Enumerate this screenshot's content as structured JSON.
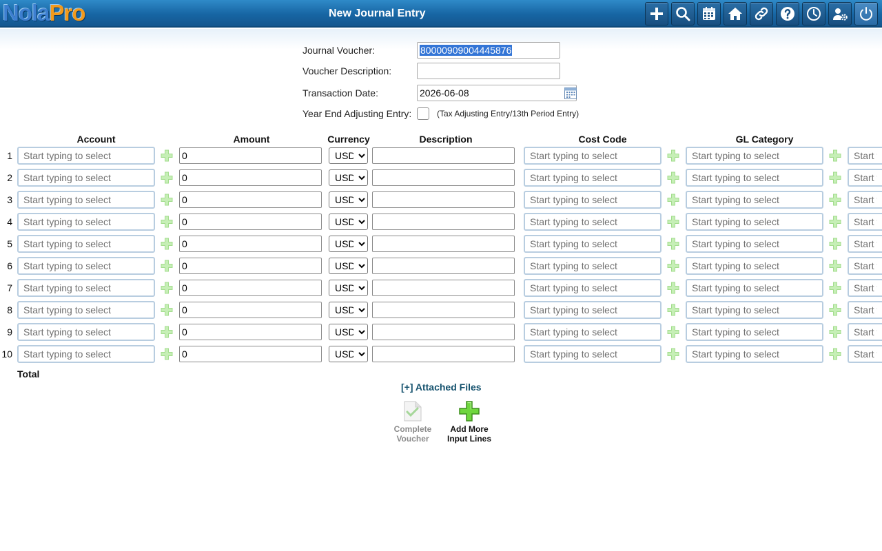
{
  "header": {
    "logo_part1": "Nola",
    "logo_part2": "Pro",
    "title": "New Journal Entry",
    "toolbar_icons": [
      "plus-icon",
      "search-icon",
      "calendar-icon",
      "home-icon",
      "link-icon",
      "help-icon",
      "clock-icon",
      "user-settings-icon",
      "power-icon"
    ]
  },
  "form": {
    "journal_voucher_label": "Journal Voucher:",
    "journal_voucher_value": "80000909004445876",
    "voucher_description_label": "Voucher Description:",
    "voucher_description_value": "",
    "transaction_date_label": "Transaction Date:",
    "transaction_date_value": "2026-06-08",
    "year_end_label": "Year End Adjusting Entry:",
    "year_end_note": "(Tax Adjusting Entry/13th Period Entry)"
  },
  "columns": {
    "account": "Account",
    "amount": "Amount",
    "currency": "Currency",
    "description": "Description",
    "cost_code": "Cost Code",
    "gl_category": "GL Category"
  },
  "rows": {
    "placeholder": "Start typing to select",
    "amount_default": "0",
    "currency_default": "USD",
    "numbers": [
      "1",
      "2",
      "3",
      "4",
      "5",
      "6",
      "7",
      "8",
      "9",
      "10"
    ]
  },
  "footer": {
    "total_label": "Total",
    "attached_files": "[+] Attached Files",
    "complete_voucher": "Complete\nVoucher",
    "add_more_lines": "Add More\nInput Lines"
  },
  "colors": {
    "header_bg": "#1765a3",
    "plus_green": "#7fd65a",
    "attach_link": "#15526e"
  }
}
